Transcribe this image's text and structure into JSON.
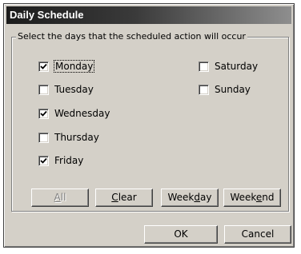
{
  "window": {
    "title": "Daily Schedule"
  },
  "group": {
    "legend": "Select the days that the scheduled action will occur"
  },
  "days": [
    {
      "label": "Monday",
      "checked": true
    },
    {
      "label": "Tuesday",
      "checked": false
    },
    {
      "label": "Wednesday",
      "checked": true
    },
    {
      "label": "Thursday",
      "checked": false
    },
    {
      "label": "Friday",
      "checked": true
    },
    {
      "label": "Saturday",
      "checked": false
    },
    {
      "label": "Sunday",
      "checked": false
    }
  ],
  "quick_buttons": {
    "all": {
      "pre": "",
      "mnemonic": "A",
      "post": "ll",
      "enabled": false
    },
    "clear": {
      "pre": "",
      "mnemonic": "C",
      "post": "lear",
      "enabled": true
    },
    "weekday": {
      "pre": "Week",
      "mnemonic": "d",
      "post": "ay",
      "enabled": true
    },
    "weekend": {
      "pre": "Week",
      "mnemonic": "e",
      "post": "nd",
      "enabled": true
    }
  },
  "footer": {
    "ok_label": "OK",
    "cancel_label": "Cancel"
  },
  "colors": {
    "face": "#d4d0c8",
    "titlebar_start": "#1c1c1c",
    "titlebar_end": "#8e8e8e",
    "disabled_text": "#808080"
  }
}
